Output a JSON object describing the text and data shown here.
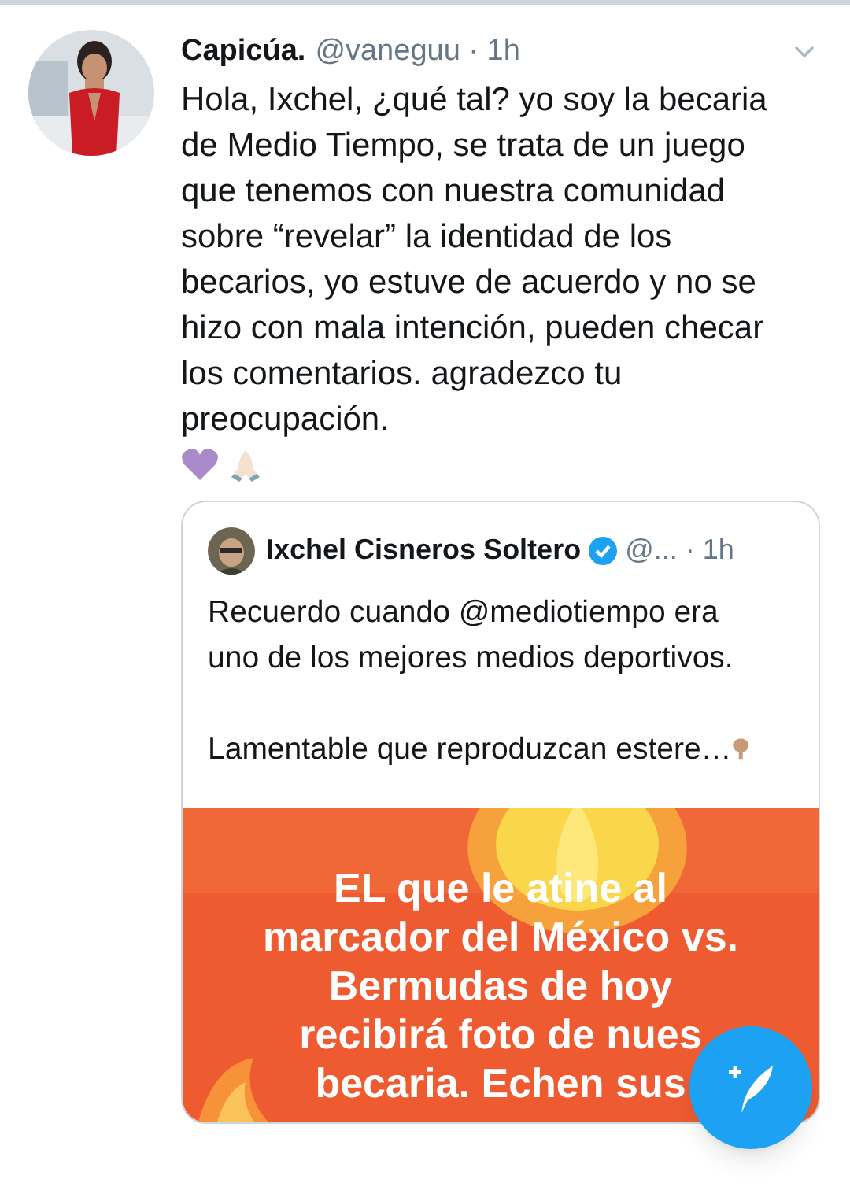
{
  "tweet": {
    "display_name": "Capicúa.",
    "meta": "@vaneguu · 1h",
    "text": "Hola, Ixchel, ¿qué tal? yo soy la becaria de Medio Tiempo, se trata de un juego que tenemos con nuestra comunidad sobre “revelar” la identidad de los becarios, yo estuve de acuerdo y no se hizo con mala intención, pueden checar los comentarios. agradezco tu preocupación.",
    "quoted_tweet": {
      "display_name": "Ixchel Cisneros Soltero",
      "verified": true,
      "meta": "@... · 1h",
      "paragraphs": [
        "Recuerdo cuando @mediotiempo era uno de los mejores medios deportivos.",
        "Lamentable que reproduzcan estere…"
      ],
      "media": {
        "kind": "picture",
        "caption_lines": [
          "EL que le atine al",
          "marcador del México vs.",
          "Bermudas de hoy",
          "recibirá foto de nues",
          "becaria. Echen sus"
        ]
      }
    }
  }
}
